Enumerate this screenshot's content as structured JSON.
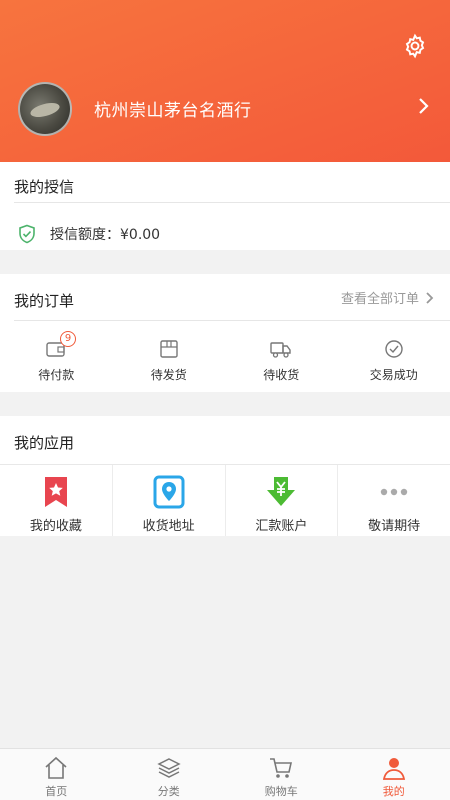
{
  "profile": {
    "shop_name": "杭州崇山茅台名酒行"
  },
  "credit": {
    "title": "我的授信",
    "amount_label": "授信额度：¥0.00"
  },
  "orders": {
    "title": "我的订单",
    "view_all": "查看全部订单",
    "items": [
      {
        "label": "待付款",
        "icon": "wallet-icon",
        "badge": "9"
      },
      {
        "label": "待发货",
        "icon": "box-icon"
      },
      {
        "label": "待收货",
        "icon": "truck-icon"
      },
      {
        "label": "交易成功",
        "icon": "check-circle-icon"
      }
    ]
  },
  "apps": {
    "title": "我的应用",
    "items": [
      {
        "label": "我的收藏",
        "icon": "bookmark-star-icon",
        "color": "#e8454f"
      },
      {
        "label": "收货地址",
        "icon": "location-pin-icon",
        "color": "#2aa6e8"
      },
      {
        "label": "汇款账户",
        "icon": "yuan-download-icon",
        "color": "#4cbb33"
      },
      {
        "label": "敬请期待",
        "icon": "more-dots-icon",
        "color": "#aaaaaa"
      }
    ]
  },
  "tabbar": {
    "items": [
      {
        "label": "首页",
        "icon": "home-icon"
      },
      {
        "label": "分类",
        "icon": "layers-icon"
      },
      {
        "label": "购物车",
        "icon": "cart-icon"
      },
      {
        "label": "我的",
        "icon": "user-icon",
        "active": true
      }
    ]
  },
  "colors": {
    "accent": "#f05a3a",
    "header_start": "#f7743e",
    "header_end": "#f3593a"
  }
}
